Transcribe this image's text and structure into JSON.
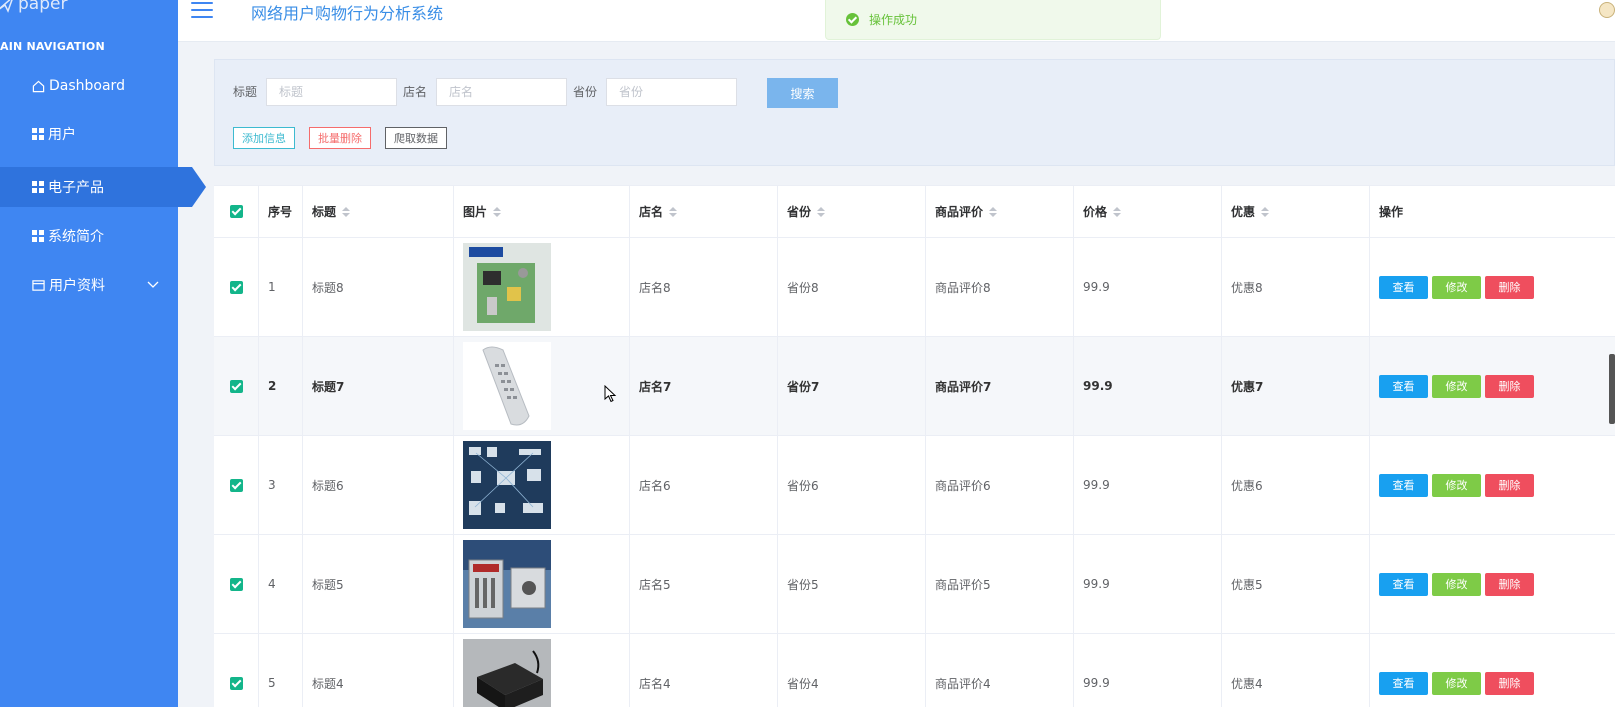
{
  "sidebar": {
    "logo_text": "paper",
    "nav_heading": "AIN NAVIGATION",
    "items": [
      {
        "label": "Dashboard"
      },
      {
        "label": "用户"
      },
      {
        "label": "电子产品"
      },
      {
        "label": "系统简介"
      },
      {
        "label": "用户资料"
      }
    ]
  },
  "header": {
    "title": "网络用户购物行为分析系统",
    "toast": "操作成功"
  },
  "search": {
    "title_label": "标题",
    "title_placeholder": "标题",
    "shop_label": "店名",
    "shop_placeholder": "店名",
    "province_label": "省份",
    "province_placeholder": "省份",
    "search_button": "搜索",
    "add_button": "添加信息",
    "batch_delete_button": "批量删除",
    "crawl_button": "爬取数据"
  },
  "table": {
    "headers": [
      "序号",
      "标题",
      "图片",
      "店名",
      "省份",
      "商品评价",
      "价格",
      "优惠",
      "操作"
    ],
    "action_labels": {
      "view": "查看",
      "edit": "修改",
      "delete": "删除"
    },
    "rows": [
      {
        "index": "1",
        "title": "标题8",
        "image": "circuit-board",
        "shop": "店名8",
        "province": "省份8",
        "review": "商品评价8",
        "price": "99.9",
        "discount": "优惠8"
      },
      {
        "index": "2",
        "title": "标题7",
        "image": "remote-control",
        "shop": "店名7",
        "province": "省份7",
        "review": "商品评价7",
        "price": "99.9",
        "discount": "优惠7"
      },
      {
        "index": "3",
        "title": "标题6",
        "image": "smart-home-diagram",
        "shop": "店名6",
        "province": "省份6",
        "review": "商品评价6",
        "price": "99.9",
        "discount": "优惠6"
      },
      {
        "index": "4",
        "title": "标题5",
        "image": "industrial-units",
        "shop": "店名5",
        "province": "省份5",
        "review": "商品评价5",
        "price": "99.9",
        "discount": "优惠5"
      },
      {
        "index": "5",
        "title": "标题4",
        "image": "black-sensor-box",
        "shop": "店名4",
        "province": "省份4",
        "review": "商品评价4",
        "price": "99.9",
        "discount": "优惠4"
      }
    ]
  },
  "colors": {
    "sidebar": "#3f86f2",
    "active_nav": "#2f73dd",
    "view": "#18a0f0",
    "edit": "#7ecb47",
    "delete": "#ef4e5e",
    "checkbox": "#13b58a"
  }
}
